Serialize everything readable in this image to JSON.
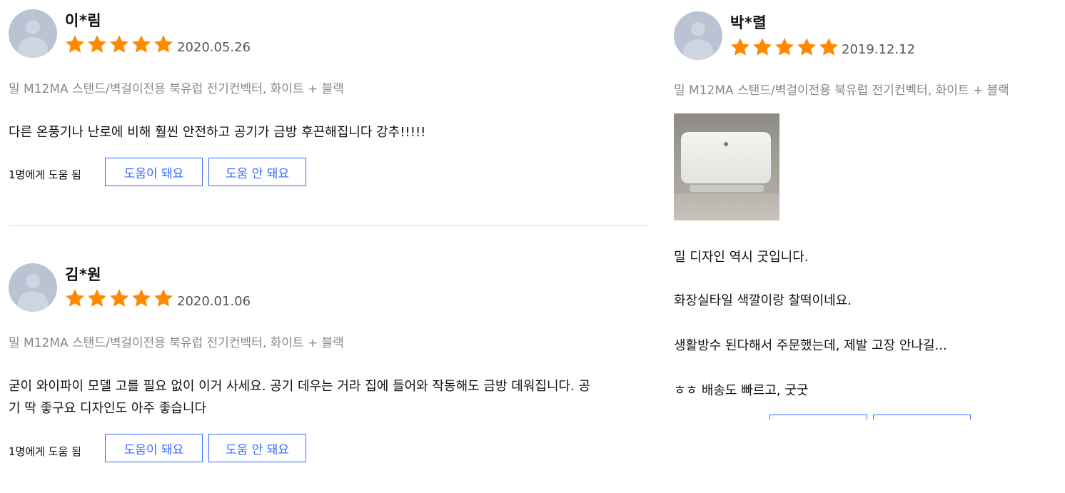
{
  "reviews": [
    {
      "name": "이*림",
      "rating": 5,
      "date": "2020.05.26",
      "option": "밀 M12MA 스탠드/벽걸이전용 북유럽 전기컨벡터, 화이트 + 블랙",
      "content_lines": [
        "다른 온풍기나 난로에 비해 훨씬 안전하고 공기가 금방 후끈해집니다 강추!!!!!"
      ],
      "helpful_text": "1명에게 도움 됨",
      "helpful_button": "도움이 돼요",
      "not_helpful_button": "도움 안 돼요"
    },
    {
      "name": "김*원",
      "rating": 5,
      "date": "2020.01.06",
      "option": "밀 M12MA 스탠드/벽걸이전용 북유럽 전기컨벡터, 화이트 + 블랙",
      "content_lines": [
        "굳이 와이파이 모델 고를 필요 없이 이거 사세요. 공기 데우는 거라 집에 들어와 작동해도 금방 데워집니다. 공",
        "기 딱 좋구요 디자인도 아주 좋습니다"
      ],
      "helpful_text": "1명에게 도움 됨",
      "helpful_button": "도움이 돼요",
      "not_helpful_button": "도움 안 돼요"
    },
    {
      "name": "박*렬",
      "rating": 5,
      "date": "2019.12.12",
      "option": "밀 M12MA 스탠드/벽걸이전용 북유럽 전기컨벡터, 화이트 + 블랙",
      "content_lines": [
        "밀 디자인 역시 굿입니다.",
        "화장실타일 색깔이랑 찰떡이네요.",
        "생활방수 된다해서 주문했는데, 제발 고장 안나길...",
        "ㅎㅎ 배송도 빠르고, 굿굿"
      ]
    }
  ],
  "colors": {
    "star": "#ff8a00",
    "button_border": "#346aff",
    "button_text": "#346aff",
    "option_text": "#888888",
    "avatar": "#b9c3d3"
  },
  "icons": {
    "avatar": "user-avatar-icon",
    "star": "star-icon"
  }
}
